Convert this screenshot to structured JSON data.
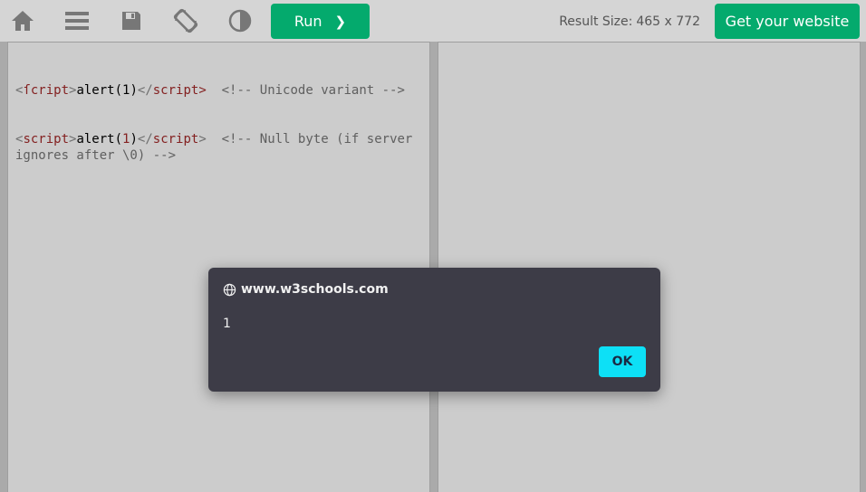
{
  "toolbar": {
    "icons": [
      "home-icon",
      "menu-icon",
      "save-icon",
      "rotate-screen-icon",
      "contrast-icon"
    ],
    "run_label": "Run",
    "run_arrow": "❯",
    "result_size_label": "Result Size:",
    "result_size_value": "465 x 772",
    "get_website_label": "Get your website"
  },
  "editor": {
    "lines": [
      {
        "open_tag": "ſcript",
        "content": "alert(1)",
        "close_tag": "script",
        "comment": "  <!-- Unicode variant -->"
      },
      {
        "open_tag": "script",
        "content_pre": "alert(",
        "content_num": "1",
        "content_post": ")",
        "close_tag": "script",
        "comment": "  <!-- Null byte (if server ignores after \\0) -->"
      }
    ]
  },
  "dialog": {
    "origin": "www.w3schools.com",
    "message": "1",
    "ok_label": "OK"
  },
  "colors": {
    "toolbar_bg": "#d5d5d5",
    "accent_green": "#04aa6d",
    "dialog_bg": "#3d3c47",
    "ok_button": "#0de0f6",
    "tag_color": "#a52a2a"
  }
}
